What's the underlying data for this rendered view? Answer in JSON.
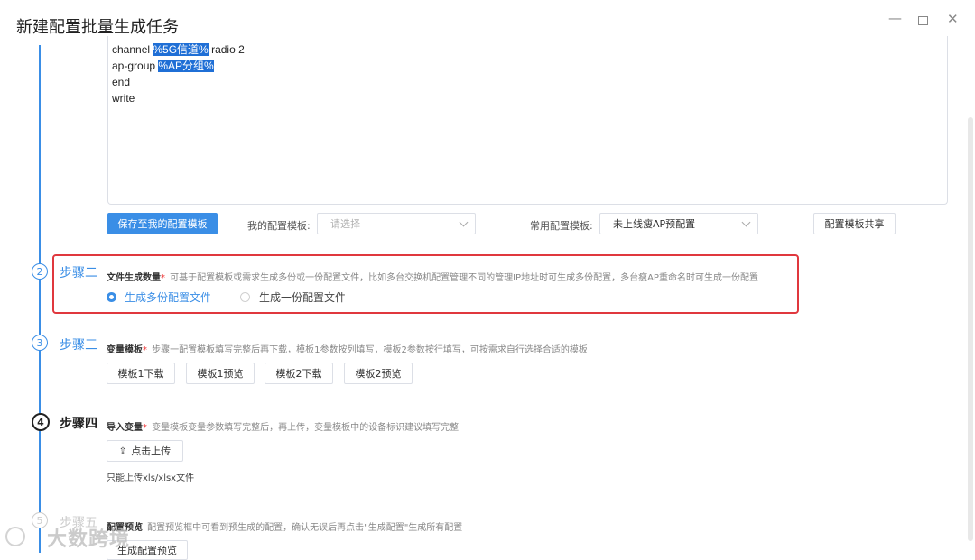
{
  "window": {
    "title": "新建配置批量生成任务",
    "minimize_glyph": "—",
    "close_glyph": "✕"
  },
  "editor": {
    "lines": [
      {
        "prefix": "channel ",
        "highlight": "%5G信道%",
        "suffix": " radio 2"
      },
      {
        "prefix": "ap-group ",
        "highlight": "%AP分组%",
        "suffix": ""
      },
      {
        "prefix": "end",
        "highlight": "",
        "suffix": ""
      },
      {
        "prefix": "write",
        "highlight": "",
        "suffix": ""
      }
    ]
  },
  "toolbar": {
    "save_label": "保存至我的配置模板",
    "my_template_label": "我的配置模板:",
    "my_template_placeholder": "请选择",
    "common_template_label": "常用配置模板:",
    "common_template_value": "未上线瘦AP预配置",
    "share_label": "配置模板共享"
  },
  "steps": [
    {
      "number": "2",
      "title": "步骤二",
      "field_label": "文件生成数量",
      "required_mark": "*",
      "hint": "可基于配置模板或需求生成多份或一份配置文件，比如多台交换机配置管理不同的管理IP地址时可生成多份配置，多台瘦AP重命名时可生成一份配置",
      "options": [
        {
          "label": "生成多份配置文件",
          "selected": true
        },
        {
          "label": "生成一份配置文件",
          "selected": false
        }
      ]
    },
    {
      "number": "3",
      "title": "步骤三",
      "field_label": "变量模板",
      "required_mark": "*",
      "hint": "步骤一配置模板填写完整后再下载，模板1参数按列填写，模板2参数按行填写，可按需求自行选择合适的模板",
      "buttons": [
        "模板1下载",
        "模板1预览",
        "模板2下载",
        "模板2预览"
      ]
    },
    {
      "number": "4",
      "title": "步骤四",
      "field_label": "导入变量",
      "required_mark": "*",
      "hint": "变量模板变量参数填写完整后，再上传，变量模板中的设备标识建议填写完整",
      "upload_label": "点击上传",
      "upload_icon": "upload-icon",
      "upload_note": "只能上传xls/xlsx文件"
    },
    {
      "number": "5",
      "title": "步骤五",
      "field_label": "配置预览",
      "hint": "配置预览框中可看到预生成的配置，确认无误后再点击\"生成配置\"生成所有配置",
      "button": "生成配置预览"
    }
  ],
  "watermark": {
    "text": "大数跨境"
  },
  "colors": {
    "accent": "#3a8ee6",
    "highlight_box": "#e0383e"
  }
}
